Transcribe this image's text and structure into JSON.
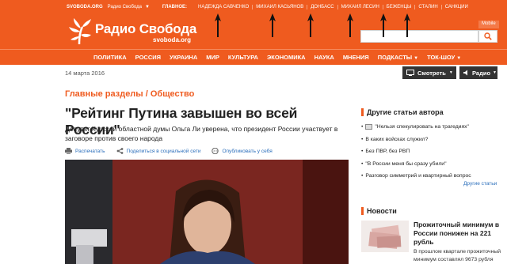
{
  "topbar": {
    "site": "SVOBODA.ORG",
    "radio": "Радио Свобода",
    "main_label": "ГЛАВНОЕ:",
    "hot_links": [
      "НАДЕЖДА САВЧЕНКО",
      "МИХАИЛ КАСЬЯНОВ",
      "ДОНБАСС",
      "МИХАИЛ ЛЕСИН",
      "БЕЖЕНЦЫ",
      "СТАЛИН",
      "САНКЦИИ"
    ]
  },
  "header": {
    "title": "Радио Свобода",
    "subtitle": "svoboda.org",
    "mobile": "Mobile",
    "search_placeholder": ""
  },
  "nav": {
    "items": [
      "ПОЛИТИКА",
      "РОССИЯ",
      "УКРАИНА",
      "МИР",
      "КУЛЬТУРА",
      "ЭКОНОМИКА",
      "НАУКА",
      "МНЕНИЯ",
      "ПОДКАСТЫ",
      "ТОК-ШОУ"
    ]
  },
  "article": {
    "date": "14 марта 2016",
    "watch": "Смотреть",
    "radio": "Радио",
    "section": "Главные разделы / Общество",
    "headline": "\"Рейтинг Путина завышен во всей России\"",
    "lead": "Депутат Курской областной думы Ольга Ли уверена, что президент России участвует в заговоре против своего народа",
    "print": "Распечатать",
    "share": "Поделиться в социальной сети",
    "publish": "Опубликовать у себя"
  },
  "sidebar": {
    "title": "Другие статьи автора",
    "items": [
      "\"Нельзя спекулировать на трагедиях\"",
      "В каких войсках служил?",
      "Без ПВР, без РВП",
      "\"В России меня бы сразу убили\"",
      "Разговор симметрий и квартирный вопрос"
    ],
    "others": "Другие статьи"
  },
  "news": {
    "title": "Новости",
    "headline": "Прожиточный минимум в России понижен на 221 рубль",
    "text": "В прошлом квартале прожиточный минимум составлял 9673 рубля"
  },
  "colors": {
    "brand": "#ef5b1f",
    "dark_button": "#333333",
    "link": "#2a6ebb"
  }
}
